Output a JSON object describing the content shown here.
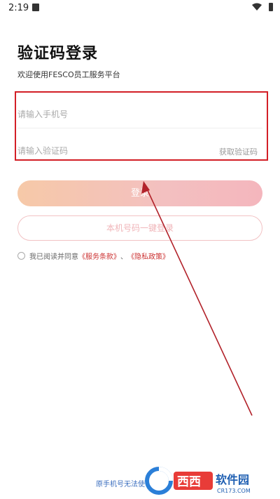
{
  "status_bar": {
    "time": "2:19",
    "icons": [
      "a-icon",
      "wifi-icon",
      "battery-icon"
    ]
  },
  "header": {
    "title": "验证码登录",
    "subtitle": "欢迎使用FESCO员工服务平台"
  },
  "form": {
    "phone_placeholder": "请输入手机号",
    "code_placeholder": "请输入验证码",
    "get_code_label": "获取验证码"
  },
  "buttons": {
    "login_label": "登录",
    "onekey_label": "本机号码一键登录"
  },
  "agreement": {
    "prefix": "我已阅读并同意",
    "service_terms": "《服务条款》",
    "separator": "、",
    "privacy_policy": "《隐私政策》"
  },
  "footer": {
    "bottom_link": "原手机号无法使"
  },
  "watermark": {
    "brand": "西西",
    "site": "软件园",
    "domain": "CR173.COM"
  },
  "colors": {
    "highlight_box": "#d31f26",
    "arrow": "#b2222a",
    "login_gradient_start": "#f6c9a8",
    "login_gradient_end": "#f4b6bd",
    "link": "#cc3333"
  }
}
